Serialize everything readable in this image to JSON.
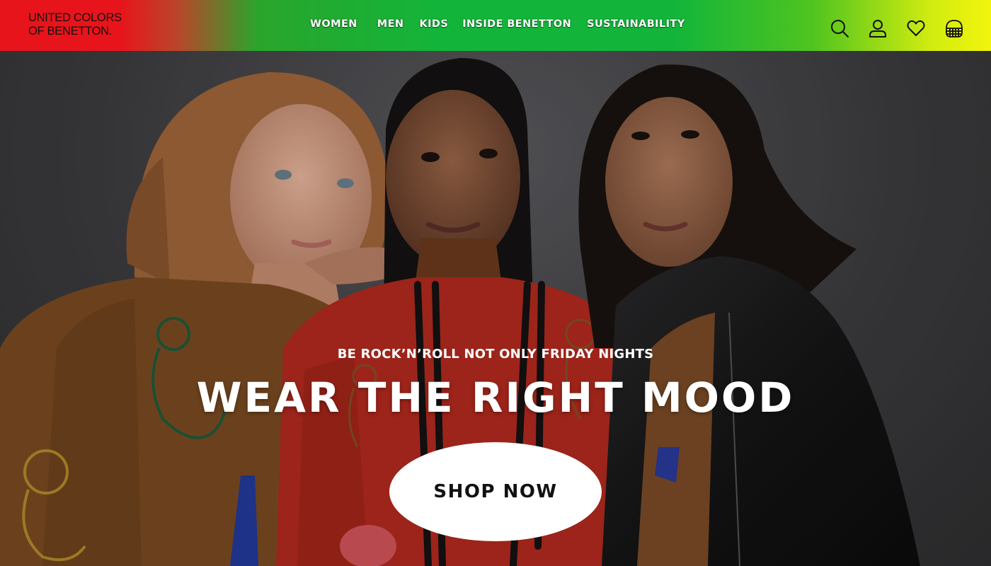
{
  "brand": {
    "line1": "UNITED COLORS",
    "line2": "OF BENETTON."
  },
  "nav": {
    "items": [
      {
        "label": "WOMEN"
      },
      {
        "label": "MEN"
      },
      {
        "label": "KIDS"
      },
      {
        "label": "INSIDE BENETTON"
      },
      {
        "label": "SUSTAINABILITY"
      }
    ]
  },
  "header_icons": [
    "search-icon",
    "account-icon",
    "wishlist-heart-icon",
    "shopping-basket-icon"
  ],
  "hero": {
    "eyebrow": "BE ROCK’N’ROLL NOT ONLY FRIDAY NIGHTS",
    "headline": "WEAR THE RIGHT MOOD",
    "cta_label": "SHOP NOW"
  },
  "colors": {
    "header_red": "#e8141b",
    "header_green": "#12b53a",
    "header_yellow": "#f2f40c",
    "cta_bg": "#ffffff"
  }
}
